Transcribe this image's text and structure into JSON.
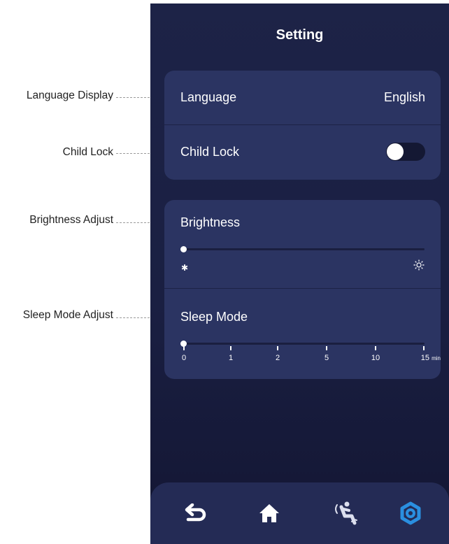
{
  "screen": {
    "title": "Setting"
  },
  "callouts": {
    "language": "Language Display",
    "child_lock": "Child Lock",
    "brightness": "Brightness Adjust",
    "sleep_mode": "Sleep Mode Adjust"
  },
  "settings": {
    "language": {
      "label": "Language",
      "value": "English"
    },
    "child_lock": {
      "label": "Child Lock",
      "enabled": false
    },
    "brightness": {
      "label": "Brightness",
      "level": 0
    },
    "sleep_mode": {
      "label": "Sleep Mode",
      "ticks": [
        "0",
        "1",
        "2",
        "5",
        "10",
        "15"
      ],
      "unit": "min",
      "selected": "0"
    }
  },
  "navbar": {
    "items": [
      {
        "icon": "back-arrow-icon",
        "active": false
      },
      {
        "icon": "home-icon",
        "active": false
      },
      {
        "icon": "massage-chair-icon",
        "active": false
      },
      {
        "icon": "gear-icon",
        "active": true
      }
    ]
  },
  "colors": {
    "background": "#1d2347",
    "card": "#2b3462",
    "active_icon": "#2a8fe0",
    "inactive_icon": "#ffffff"
  }
}
